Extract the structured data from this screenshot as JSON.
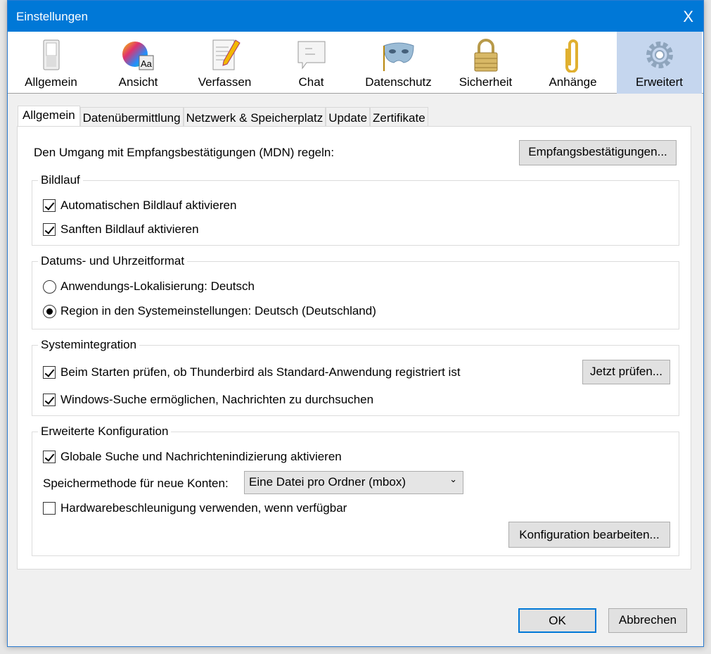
{
  "window": {
    "title": "Einstellungen",
    "close": "X"
  },
  "toolbar": [
    {
      "label": "Allgemein",
      "icon": "switch-icon"
    },
    {
      "label": "Ansicht",
      "icon": "palette-font-icon"
    },
    {
      "label": "Verfassen",
      "icon": "compose-pencil-icon"
    },
    {
      "label": "Chat",
      "icon": "chat-bubble-icon"
    },
    {
      "label": "Datenschutz",
      "icon": "mask-icon"
    },
    {
      "label": "Sicherheit",
      "icon": "padlock-icon"
    },
    {
      "label": "Anhänge",
      "icon": "paperclip-icon"
    },
    {
      "label": "Erweitert",
      "icon": "gear-icon",
      "selected": true
    }
  ],
  "tabs": [
    "Allgemein",
    "Datenübermittlung",
    "Netzwerk & Speicherplatz",
    "Update",
    "Zertifikate"
  ],
  "mdn": {
    "text": "Den Umgang mit Empfangsbestätigungen (MDN) regeln:",
    "button": "Empfangsbestätigungen..."
  },
  "scrolling": {
    "legend": "Bildlauf",
    "items": [
      {
        "label": "Automatischen Bildlauf aktivieren",
        "checked": true
      },
      {
        "label": "Sanften Bildlauf aktivieren",
        "checked": true
      }
    ]
  },
  "datetime": {
    "legend": "Datums- und Uhrzeitformat",
    "options": [
      {
        "label": "Anwendungs-Lokalisierung: Deutsch",
        "selected": false
      },
      {
        "label": "Region in den Systemeinstellungen: Deutsch (Deutschland)",
        "selected": true
      }
    ]
  },
  "system": {
    "legend": "Systemintegration",
    "items": [
      {
        "label": "Beim Starten prüfen, ob Thunderbird als Standard-Anwendung registriert ist",
        "checked": true
      },
      {
        "label": "Windows-Suche ermöglichen, Nachrichten zu durchsuchen",
        "checked": true
      }
    ],
    "button": "Jetzt prüfen..."
  },
  "advanced": {
    "legend": "Erweiterte Konfiguration",
    "indexing": {
      "label": "Globale Suche und Nachrichtenindizierung aktivieren",
      "checked": true
    },
    "storage_label": "Speichermethode für neue Konten:",
    "storage_value": "Eine Datei pro Ordner (mbox)",
    "hw": {
      "label": "Hardwarebeschleunigung verwenden, wenn verfügbar",
      "checked": false
    },
    "button": "Konfiguration bearbeiten..."
  },
  "footer": {
    "ok": "OK",
    "cancel": "Abbrechen"
  }
}
